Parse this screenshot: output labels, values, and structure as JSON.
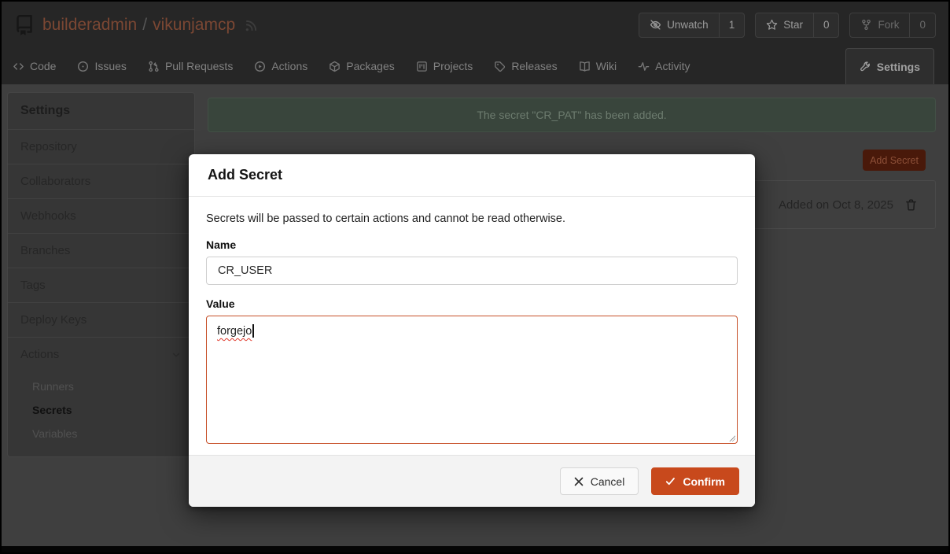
{
  "header": {
    "owner": "builderadmin",
    "separator": "/",
    "repo": "vikunjamcp",
    "watch": {
      "label": "Unwatch",
      "count": "1"
    },
    "star": {
      "label": "Star",
      "count": "0"
    },
    "fork": {
      "label": "Fork",
      "count": "0"
    }
  },
  "tabs": [
    {
      "label": "Code"
    },
    {
      "label": "Issues"
    },
    {
      "label": "Pull Requests"
    },
    {
      "label": "Actions"
    },
    {
      "label": "Packages"
    },
    {
      "label": "Projects"
    },
    {
      "label": "Releases"
    },
    {
      "label": "Wiki"
    },
    {
      "label": "Activity"
    },
    {
      "label": "Settings",
      "active": true
    }
  ],
  "sidebar": {
    "title": "Settings",
    "items": [
      {
        "label": "Repository"
      },
      {
        "label": "Collaborators"
      },
      {
        "label": "Webhooks"
      },
      {
        "label": "Branches"
      },
      {
        "label": "Tags"
      },
      {
        "label": "Deploy Keys"
      }
    ],
    "actions_group": {
      "label": "Actions",
      "sub_items": [
        {
          "label": "Runners",
          "active": false
        },
        {
          "label": "Secrets",
          "active": true
        },
        {
          "label": "Variables",
          "active": false
        }
      ]
    }
  },
  "banner": {
    "message": "The secret \"CR_PAT\" has been added."
  },
  "secrets_section": {
    "add_button_label": "Add Secret",
    "existing_secret_added": "Added on Oct 8, 2025"
  },
  "modal": {
    "title": "Add Secret",
    "description": "Secrets will be passed to certain actions and cannot be read otherwise.",
    "name_label": "Name",
    "name_value": "CR_USER",
    "value_label": "Value",
    "value_text": "forgejo",
    "cancel_label": "Cancel",
    "confirm_label": "Confirm"
  },
  "colors": {
    "primary_orange": "#c8491c",
    "textarea_focus_border": "#c75029",
    "success_banner_bg_dimmed": "#39453c",
    "dim_overlay_bg": "#3f3f3f",
    "modal_bg": "#ffffff",
    "spellcheck_squiggle": "#e03a2c"
  }
}
